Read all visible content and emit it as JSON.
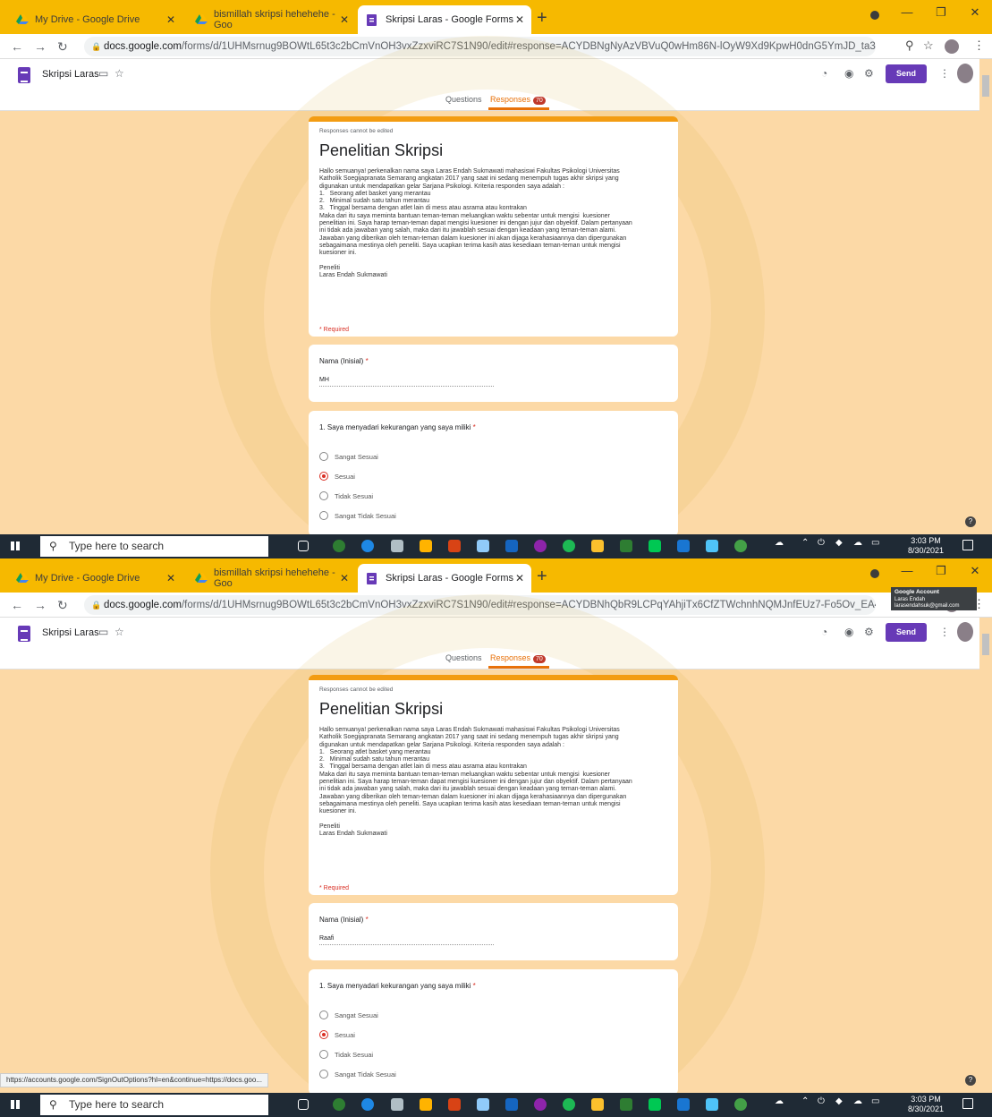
{
  "browser": {
    "tabs": [
      {
        "title": "My Drive - Google Drive"
      },
      {
        "title": "bismillah skripsi hehehehe - Goo"
      },
      {
        "title": "Skripsi Laras - Google Forms"
      }
    ],
    "new_tab": "+",
    "win_controls": {
      "minimize": "—",
      "maximize": "❐",
      "close": "✕"
    }
  },
  "screens": [
    {
      "url_domain": "docs.google.com",
      "url_path": "/forms/d/1UHMsrnug9BOWtL65t3c2bCmVnOH3vxZzxviRC7S1N90/edit#response=ACYDBNgNyAzVBVuQ0wHm86N-lOyW9Xd9KpwH0dnG5YmJD_ta3MTvo...",
      "answer_name": "MH",
      "selected_option_index": 1
    },
    {
      "url_domain": "docs.google.com",
      "url_path": "/forms/d/1UHMsrnug9BOWtL65t3c2bCmVnOH3vxZzxviRC7S1N90/edit#response=ACYDBNhQbR9LCPqYAhjiTx6CfZTWchnhNQMJnfEUz7-Fo5Ov_EA4sUfq_i...",
      "answer_name": "Raafi",
      "selected_option_index": 1
    }
  ],
  "form_header": {
    "title": "Skripsi Laras",
    "send_label": "Send",
    "questions_tab": "Questions",
    "responses_tab": "Responses",
    "responses_count": "70"
  },
  "form": {
    "notice": "Responses cannot be edited",
    "title": "Penelitian Skripsi",
    "description": "Hallo semuanya! perkenalkan nama saya Laras Endah Sukmawati mahasiswi Fakultas Psikologi Universitas\nKatholik Soegijapranata Semarang angkatan 2017 yang saat ini sedang menempuh tugas akhir skripsi yang\ndigunakan untuk mendapatkan gelar Sarjana Psikologi. Kriteria responden saya adalah :\n1.   Seorang atlet basket yang merantau\n2.   Minimal sudah satu tahun merantau\n3.   Tinggal bersama dengan atlet lain di mess atau asrama atau kontrakan\nMaka dari itu saya meminta bantuan teman-teman meluangkan waktu sebentar untuk mengisi  kuesioner\npenelitian ini. Saya harap teman-teman dapat mengisi kuesioner ini dengan jujur dan obyektif. Dalam pertanyaan\nini tidak ada jawaban yang salah, maka dari itu jawablah sesuai dengan keadaan yang teman-teman alami.\nJawaban yang diberikan oleh teman-teman dalam kuesioner ini akan dijaga kerahasiaannya dan dipergunakan\nsebagaimana mestinya oleh peneliti. Saya ucapkan terima kasih atas kesediaan teman-teman untuk mengisi\nkuesioner ini.\n\nPeneliti\nLaras Endah Sukmawati",
    "required_note": "* Required",
    "name_question": "Nama (Inisial)",
    "q1": "1. Saya menyadari kekurangan yang saya miliki",
    "options": [
      "Sangat Sesuai",
      "Sesuai",
      "Tidak Sesuai",
      "Sangat Tidak Sesuai"
    ]
  },
  "taskbar": {
    "search_placeholder": "Type here to search",
    "time": "3:03 PM",
    "date": "8/30/2021"
  },
  "tooltip": {
    "title": "Google Account",
    "name": "Laras Endah",
    "email": "larasendahsuk@gmail.com"
  },
  "status_url": "https://accounts.google.com/SignOutOptions?hl=en&continue=https://docs.goo...",
  "colors": {
    "chrome_tab": "#f6b900",
    "accent": "#673ab7",
    "form_theme": "#f39c12",
    "required": "#d93025"
  }
}
